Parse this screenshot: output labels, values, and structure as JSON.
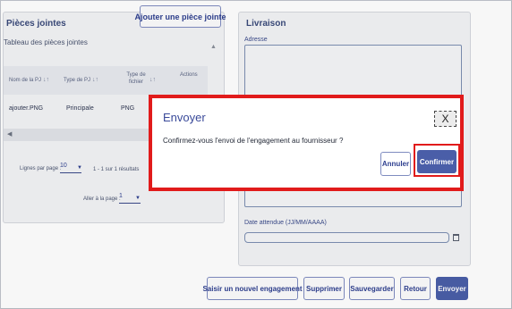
{
  "attachments": {
    "title": "Pièces jointes",
    "add_button": "Ajouter une pièce jointe",
    "table_caption": "Tableau des pièces jointes",
    "columns": {
      "name": "Nom de la PJ",
      "type": "Type de PJ",
      "file_type": "Type de fichier",
      "actions": "Actions"
    },
    "sort_symbol": "↓↑",
    "row": {
      "name": "ajouter.PNG",
      "type": "Principale",
      "file_type": "PNG"
    },
    "pagination": {
      "per_page_label": "Lignes par page :",
      "per_page_value": "10",
      "range": "1 - 1 sur 1 résultats",
      "goto_label": "Aller à la page :",
      "goto_value": "1"
    }
  },
  "delivery": {
    "title": "Livraison",
    "address_label": "Adresse",
    "date_label": "Date attendue (JJ/MM/AAAA)"
  },
  "actions": {
    "new_commitment": "Saisir un nouvel engagement",
    "delete": "Supprimer",
    "save": "Sauvegarder",
    "back": "Retour",
    "send": "Envoyer"
  },
  "modal": {
    "title": "Envoyer",
    "close": "X",
    "message": "Confirmez-vous l'envoi de l'engagement au fournisseur ?",
    "cancel": "Annuler",
    "confirm": "Confirmer"
  },
  "colors": {
    "accent": "#4a5ea8",
    "highlight": "#e11b1b"
  }
}
